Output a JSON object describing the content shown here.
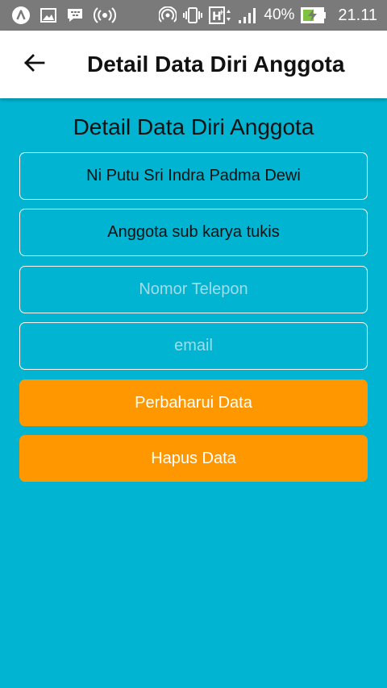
{
  "status_bar": {
    "icons_left": [
      "app-notification-icon",
      "image-icon",
      "bbm-icon",
      "hotspot-icon"
    ],
    "icons_right": [
      "nfc-icon",
      "vibrate-icon",
      "hplus-network-icon",
      "signal-icon",
      "battery-charging-icon"
    ],
    "battery_percent": "40%",
    "time": "21.11"
  },
  "app_bar": {
    "title": "Detail Data Diri Anggota"
  },
  "form": {
    "heading": "Detail Data Diri Anggota",
    "name_value": "Ni Putu Sri Indra Padma Dewi",
    "role_value": "Anggota sub karya tukis",
    "phone_placeholder": "Nomor Telepon",
    "email_placeholder": "email",
    "update_label": "Perbaharui Data",
    "delete_label": "Hapus Data"
  },
  "colors": {
    "background": "#00b4d2",
    "button": "#ff9800",
    "status_bar": "#7a7a7a",
    "app_bar": "#ffffff"
  }
}
